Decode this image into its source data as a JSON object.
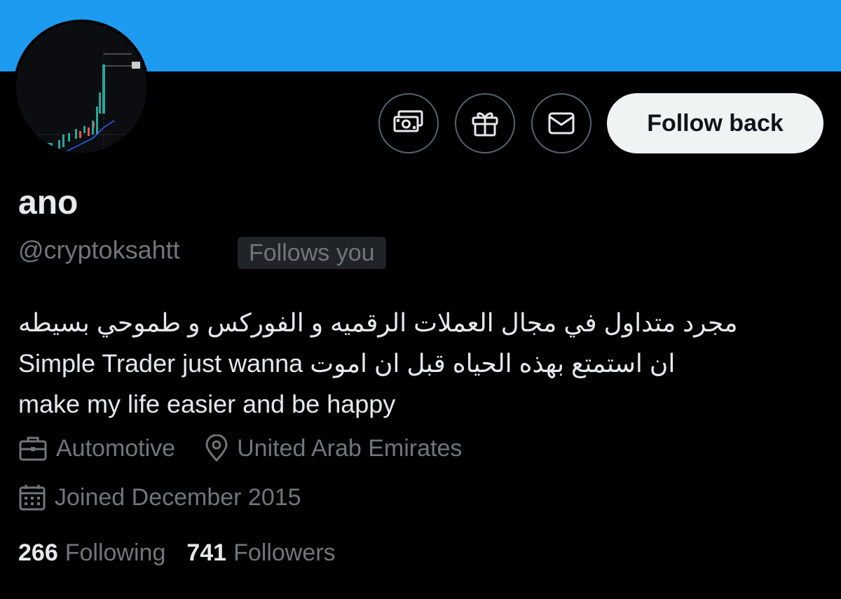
{
  "profile": {
    "display_name": "ano",
    "handle": "@cryptoksahtt",
    "follows_you_badge": "Follows you",
    "bio_line1": "مجرد متداول في مجال العملات الرقميه و الفوركس و طموحي بسيطه",
    "bio_line2": "Simple Trader just wanna ان استمتع بهذه الحياه قبل ان اموت",
    "bio_line3": "make my life easier and be happy",
    "category": "Automotive",
    "location": "United Arab Emirates",
    "joined": "Joined December 2015"
  },
  "actions": {
    "follow_label": "Follow back",
    "icons": [
      "money-icon",
      "gift-icon",
      "mail-icon"
    ]
  },
  "stats": {
    "following_count": "266",
    "following_label": "Following",
    "followers_count": "741",
    "followers_label": "Followers"
  },
  "colors": {
    "banner": "#1d9bf0",
    "background": "#000000",
    "text_primary": "#e7e9ea",
    "text_secondary": "#71767b",
    "button_bg": "#eff3f4"
  }
}
